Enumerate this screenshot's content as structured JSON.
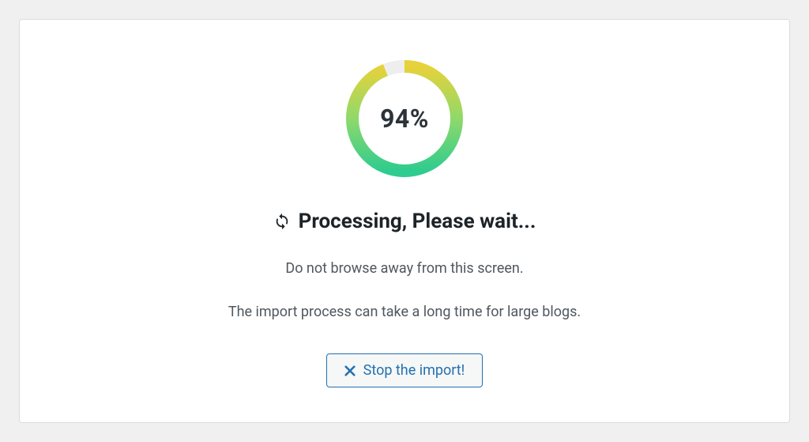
{
  "progress": {
    "percent": 94,
    "display": "94%"
  },
  "heading": "Processing, Please wait...",
  "message1": "Do not browse away from this screen.",
  "message2": "The import process can take a long time for large blogs.",
  "stop_button_label": "Stop the import!",
  "colors": {
    "ring_start": "#2ecc8f",
    "ring_end": "#e7d23a",
    "accent": "#2271b1"
  }
}
